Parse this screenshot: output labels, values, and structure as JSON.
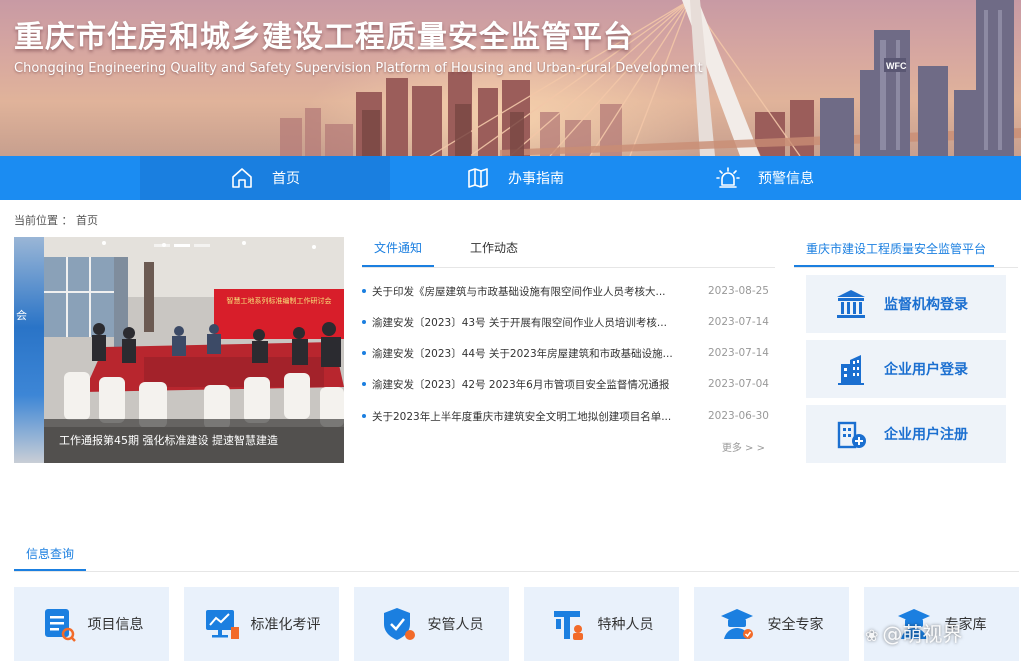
{
  "header": {
    "title": "重庆市住房和城乡建设工程质量安全监管平台",
    "subtitle": "Chongqing Engineering Quality and Safety Supervision Platform of Housing and Urban-rural Development"
  },
  "nav": {
    "items": [
      {
        "label": "首页",
        "icon": "home-icon",
        "active": true
      },
      {
        "label": "办事指南",
        "icon": "map-icon",
        "active": false
      },
      {
        "label": "预警信息",
        "icon": "alarm-icon",
        "active": false
      }
    ]
  },
  "breadcrumb": {
    "prefix": "当前位置 ：",
    "current": "首页"
  },
  "carousel": {
    "caption": "工作通报第45期 强化标准建设 提速智慧建造",
    "banner_text": "智慧工地系列标准编制工作研讨会",
    "prev_slide_text": "会"
  },
  "news": {
    "tabs": [
      {
        "label": "文件通知",
        "active": true
      },
      {
        "label": "工作动态",
        "active": false
      }
    ],
    "items": [
      {
        "title": "关于印发《房屋建筑与市政基础设施有限空间作业人员考核大...",
        "date": "2023-08-25"
      },
      {
        "title": "渝建安发〔2023〕43号 关于开展有限空间作业人员培训考核...",
        "date": "2023-07-14"
      },
      {
        "title": "渝建安发〔2023〕44号 关于2023年房屋建筑和市政基础设施...",
        "date": "2023-07-14"
      },
      {
        "title": "渝建安发〔2023〕42号 2023年6月市管项目安全监督情况通报",
        "date": "2023-07-04"
      },
      {
        "title": "关于2023年上半年度重庆市建筑安全文明工地拟创建项目名单...",
        "date": "2023-06-30"
      }
    ],
    "more": "更多 > >"
  },
  "panel": {
    "title": "重庆市建设工程质量安全监管平台",
    "buttons": [
      {
        "label": "监督机构登录",
        "icon": "institution-icon"
      },
      {
        "label": "企业用户登录",
        "icon": "building-icon"
      },
      {
        "label": "企业用户注册",
        "icon": "register-icon"
      }
    ]
  },
  "query": {
    "tab": "信息查询",
    "tiles": [
      {
        "label": "项目信息",
        "icon": "project-info-icon"
      },
      {
        "label": "标准化考评",
        "icon": "evaluation-icon"
      },
      {
        "label": "安管人员",
        "icon": "safety-manager-icon"
      },
      {
        "label": "特种人员",
        "icon": "special-worker-icon"
      },
      {
        "label": "安全专家",
        "icon": "safety-expert-icon"
      },
      {
        "label": "专家库",
        "icon": "expert-db-icon"
      }
    ]
  },
  "watermark": "@萌视界",
  "colors": {
    "primary": "#1b8cf2",
    "link": "#1b7fe0",
    "tile_bg": "#e9f1fb"
  }
}
